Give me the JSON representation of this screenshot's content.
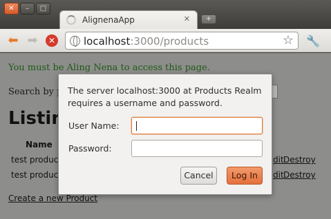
{
  "browser": {
    "tab_title": "AlignenaApp",
    "url_host": "localhost",
    "url_path": ":3000/products"
  },
  "page": {
    "notice": "You must be Aling Nena to access this page.",
    "search_label": "Search by p",
    "heading": "Listing",
    "table": {
      "headers": [
        "Name"
      ],
      "rows": [
        {
          "name": "test product",
          "edit": "dit",
          "destroy": "Destroy"
        },
        {
          "name": "test product",
          "edit": "dit",
          "destroy": "Destroy"
        }
      ]
    },
    "new_link": "Create a new Product"
  },
  "dialog": {
    "message": "The server localhost:3000 at Products Realm requires a username and password.",
    "username_label": "User Name:",
    "password_label": "Password:",
    "username_value": "",
    "password_value": "",
    "cancel_label": "Cancel",
    "login_label": "Log In"
  },
  "colors": {
    "accent": "#e4703d",
    "notice_text": "#1d5a14"
  },
  "icons": [
    "close-icon",
    "minimize-icon",
    "maximize-icon",
    "loading-icon",
    "back-icon",
    "forward-icon",
    "stop-icon",
    "globe-icon",
    "star-icon",
    "wrench-icon"
  ]
}
